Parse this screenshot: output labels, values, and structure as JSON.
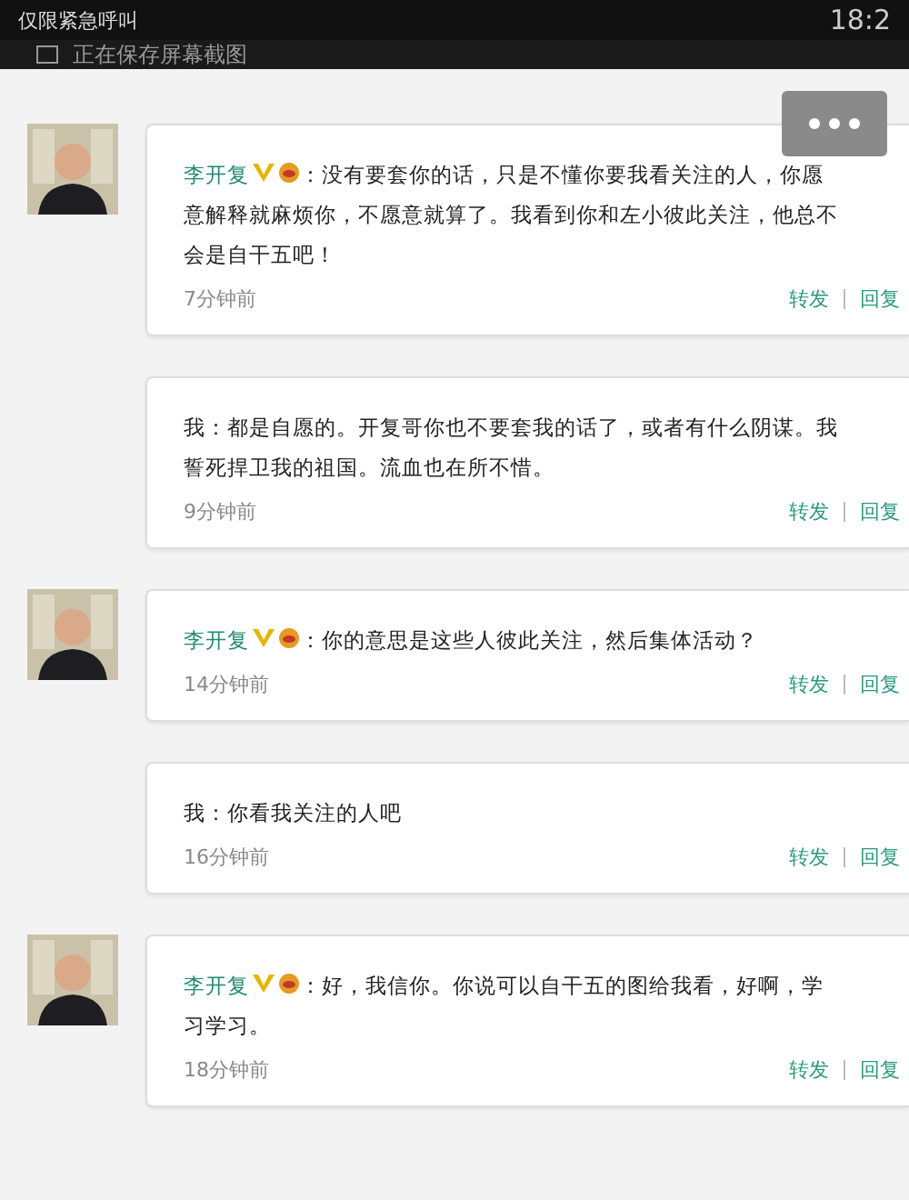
{
  "status_bar": {
    "carrier": "仅限紧急呼叫",
    "time": "18:2"
  },
  "notification": {
    "text": "正在保存屏幕截图"
  },
  "comments": [
    {
      "kind": "other",
      "name": "李开复",
      "lines": [
        "：没有要套你的话，只是不懂你要我看关注的人，你愿",
        "意解释就麻烦你，不愿意就算了。我看到你和左小彼此关注，他总不",
        "会是自干五吧！"
      ],
      "time": "7分钟前",
      "actions": [
        "转发",
        "回复"
      ]
    },
    {
      "kind": "self",
      "lines": [
        "我：都是自愿的。开复哥你也不要套我的话了，或者有什么阴谋。我",
        "誓死捍卫我的祖国。流血也在所不惜。"
      ],
      "time": "9分钟前",
      "actions": [
        "转发",
        "回复"
      ]
    },
    {
      "kind": "other",
      "name": "李开复",
      "lines": [
        "：你的意思是这些人彼此关注，然后集体活动？"
      ],
      "time": "14分钟前",
      "actions": [
        "转发",
        "回复"
      ]
    },
    {
      "kind": "self",
      "lines": [
        "我：你看我关注的人吧"
      ],
      "time": "16分钟前",
      "actions": [
        "转发",
        "回复"
      ]
    },
    {
      "kind": "other",
      "name": "李开复",
      "lines": [
        "：好，我信你。你说可以自干五的图给我看，好啊，学",
        "习学习。"
      ],
      "time": "18分钟前",
      "actions": [
        "转发",
        "回复"
      ]
    }
  ]
}
